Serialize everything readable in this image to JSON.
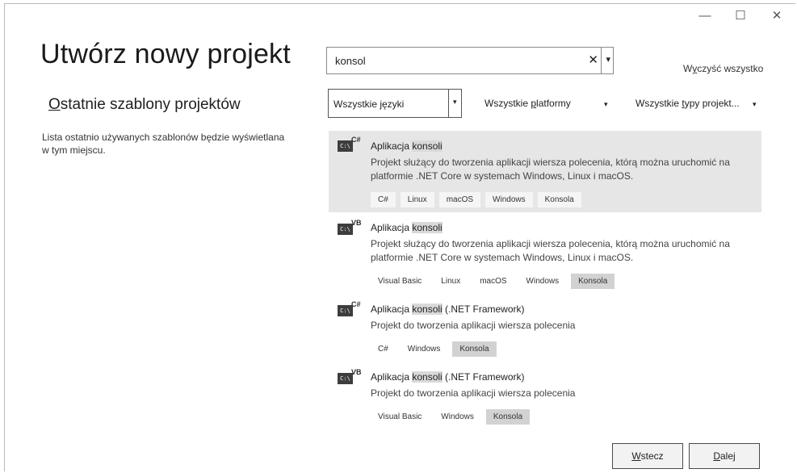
{
  "window": {
    "minimize_label": "—",
    "maximize_label": "☐",
    "close_label": "✕"
  },
  "header": {
    "title": "Utwórz nowy projekt"
  },
  "recent": {
    "title_first": "O",
    "title_rest": "statnie szablony projektów",
    "description": "Lista ostatnio używanych szablonów będzie wyświetlana w tym miejscu."
  },
  "search": {
    "value": "konsol",
    "clear_icon": "✕",
    "dropdown_icon": "▾",
    "clear_all_pre": "W",
    "clear_all_u": "y",
    "clear_all_post": "czyść wszystko"
  },
  "filters": {
    "language": "Wszystkie języki",
    "platform_pre": "Wszystkie ",
    "platform_u": "p",
    "platform_post": "latformy",
    "project_type_pre": "Wszystkie ",
    "project_type_u": "t",
    "project_type_post": "ypy projekt..."
  },
  "templates": [
    {
      "lang_badge": "C#",
      "title_pre": "Aplikacja ",
      "title_hl": "konsoli",
      "title_post": "",
      "description": "Projekt służący do tworzenia aplikacji wiersza polecenia, którą można uruchomić na platformie .NET Core w systemach Windows, Linux i macOS.",
      "tags": [
        "C#",
        "Linux",
        "macOS",
        "Windows",
        "Konsola"
      ],
      "selected": true
    },
    {
      "lang_badge": "VB",
      "title_pre": "Aplikacja ",
      "title_hl": "konsoli",
      "title_post": "",
      "description": "Projekt służący do tworzenia aplikacji wiersza polecenia, którą można uruchomić na platformie .NET Core w systemach Windows, Linux i macOS.",
      "tags": [
        "Visual Basic",
        "Linux",
        "macOS",
        "Windows",
        "Konsola"
      ],
      "selected": false
    },
    {
      "lang_badge": "C#",
      "title_pre": "Aplikacja ",
      "title_hl": "konsoli",
      "title_post": " (.NET Framework)",
      "description": "Projekt do tworzenia aplikacji wiersza polecenia",
      "tags": [
        "C#",
        "Windows",
        "Konsola"
      ],
      "selected": false
    },
    {
      "lang_badge": "VB",
      "title_pre": "Aplikacja ",
      "title_hl": "konsoli",
      "title_post": " (.NET Framework)",
      "description": "Projekt do tworzenia aplikacji wiersza polecenia",
      "tags": [
        "Visual Basic",
        "Windows",
        "Konsola"
      ],
      "selected": false
    }
  ],
  "footer": {
    "back_u": "W",
    "back_rest": "stecz",
    "next_u": "D",
    "next_rest": "alej"
  }
}
